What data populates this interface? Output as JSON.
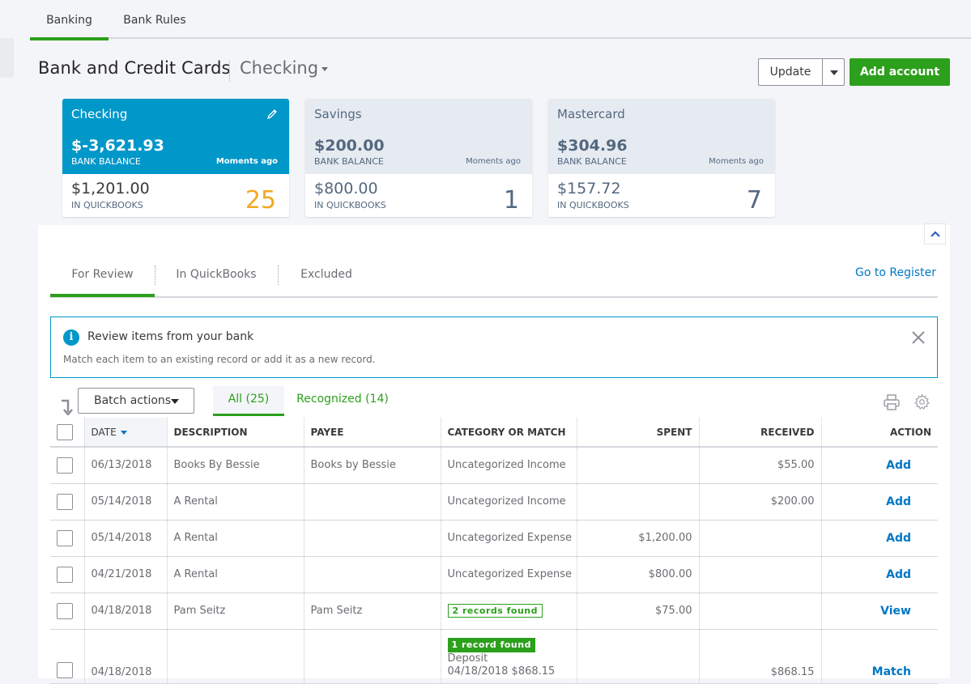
{
  "top_tabs": [
    {
      "label": "Banking",
      "active": true
    },
    {
      "label": "Bank Rules",
      "active": false
    }
  ],
  "header": {
    "title": "Bank and Credit Cards",
    "account_selected": "Checking",
    "update_label": "Update",
    "add_account_label": "Add account"
  },
  "accounts": [
    {
      "name": "Checking",
      "bank_balance": "$-3,621.93",
      "bank_balance_label": "BANK BALANCE",
      "updated": "Moments ago",
      "qb_balance": "$1,201.00",
      "qb_label": "IN QUICKBOOKS",
      "count": "25",
      "active": true
    },
    {
      "name": "Savings",
      "bank_balance": "$200.00",
      "bank_balance_label": "BANK BALANCE",
      "updated": "Moments ago",
      "qb_balance": "$800.00",
      "qb_label": "IN QUICKBOOKS",
      "count": "1",
      "active": false
    },
    {
      "name": "Mastercard",
      "bank_balance": "$304.96",
      "bank_balance_label": "BANK BALANCE",
      "updated": "Moments ago",
      "qb_balance": "$157.72",
      "qb_label": "IN QUICKBOOKS",
      "count": "7",
      "active": false
    }
  ],
  "sub_tabs": [
    {
      "label": "For Review",
      "active": true
    },
    {
      "label": "In QuickBooks",
      "active": false
    },
    {
      "label": "Excluded",
      "active": false
    }
  ],
  "go_to_register": "Go to Register",
  "info": {
    "title": "Review items from your bank",
    "text": "Match each item to an existing record or add it as a new record."
  },
  "toolbar": {
    "batch_actions": "Batch actions",
    "filters": [
      {
        "label": "All (25)",
        "active": true
      },
      {
        "label": "Recognized (14)",
        "active": false
      }
    ]
  },
  "table": {
    "columns": [
      "DATE",
      "DESCRIPTION",
      "PAYEE",
      "CATEGORY OR MATCH",
      "SPENT",
      "RECEIVED",
      "ACTION"
    ],
    "rows": [
      {
        "date": "06/13/2018",
        "description": "Books By Bessie",
        "payee": "Books by Bessie",
        "category": "Uncategorized Income",
        "spent": "",
        "received": "$55.00",
        "action": "Add"
      },
      {
        "date": "05/14/2018",
        "description": "A Rental",
        "payee": "",
        "category": "Uncategorized Income",
        "spent": "",
        "received": "$200.00",
        "action": "Add"
      },
      {
        "date": "05/14/2018",
        "description": "A Rental",
        "payee": "",
        "category": "Uncategorized Expense",
        "spent": "$1,200.00",
        "received": "",
        "action": "Add"
      },
      {
        "date": "04/21/2018",
        "description": "A Rental",
        "payee": "",
        "category": "Uncategorized Expense",
        "spent": "$800.00",
        "received": "",
        "action": "Add"
      },
      {
        "date": "04/18/2018",
        "description": "Pam Seitz",
        "payee": "Pam Seitz",
        "category_badge": "2 records found",
        "spent": "$75.00",
        "received": "",
        "action": "View"
      },
      {
        "date": "04/18/2018",
        "description": "",
        "payee": "",
        "category_badge": "1 record found",
        "category_line1": "Deposit",
        "category_line2": "04/18/2018 $868.15",
        "spent": "",
        "received": "$868.15",
        "action": "Match"
      }
    ]
  },
  "colors": {
    "brand_green": "#2ca01c",
    "active_card_blue": "#0097c9",
    "link_blue": "#0077c5",
    "count_orange": "#f3a823"
  }
}
